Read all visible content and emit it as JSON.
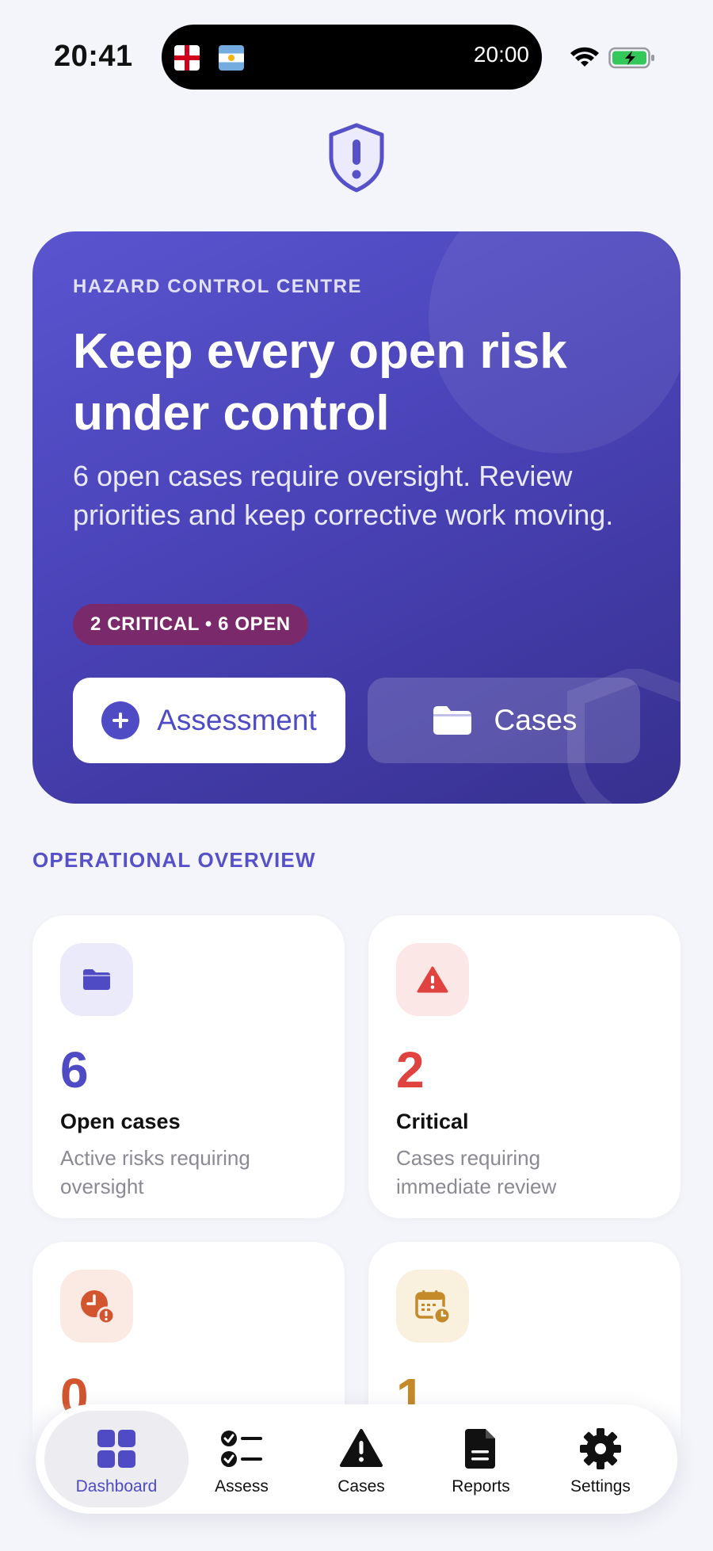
{
  "status_bar": {
    "time": "20:41",
    "island_time": "20:00",
    "flags": [
      "england-flag",
      "argentina-flag"
    ],
    "battery_color": "#34c759"
  },
  "colors": {
    "accent": "#4f4bc4",
    "critical": "#e0433f",
    "overdue": "#d2552f",
    "due": "#c48a2a",
    "background": "#f4f5fa"
  },
  "hero": {
    "eyebrow": "HAZARD CONTROL CENTRE",
    "title": "Keep every open risk under control",
    "description": "6 open cases require oversight. Review priorities and keep corrective work moving.",
    "badge": "2 CRITICAL • 6 OPEN",
    "primary_button": "Assessment",
    "secondary_button": "Cases"
  },
  "overview": {
    "title": "OPERATIONAL OVERVIEW",
    "cards": [
      {
        "value": "6",
        "label": "Open cases",
        "sub": "Active risks requiring oversight",
        "icon": "folder-icon"
      },
      {
        "value": "2",
        "label": "Critical",
        "sub": "Cases requiring immediate review",
        "icon": "warning-icon"
      },
      {
        "value": "0",
        "label": "",
        "sub": "",
        "icon": "clock-alert-icon"
      },
      {
        "value": "1",
        "label": "",
        "sub": "",
        "icon": "calendar-clock-icon"
      }
    ]
  },
  "tabs": [
    {
      "label": "Dashboard",
      "icon": "grid-icon",
      "active": true
    },
    {
      "label": "Assess",
      "icon": "checklist-icon",
      "active": false
    },
    {
      "label": "Cases",
      "icon": "warning-icon",
      "active": false
    },
    {
      "label": "Reports",
      "icon": "document-icon",
      "active": false
    },
    {
      "label": "Settings",
      "icon": "gear-icon",
      "active": false
    }
  ]
}
